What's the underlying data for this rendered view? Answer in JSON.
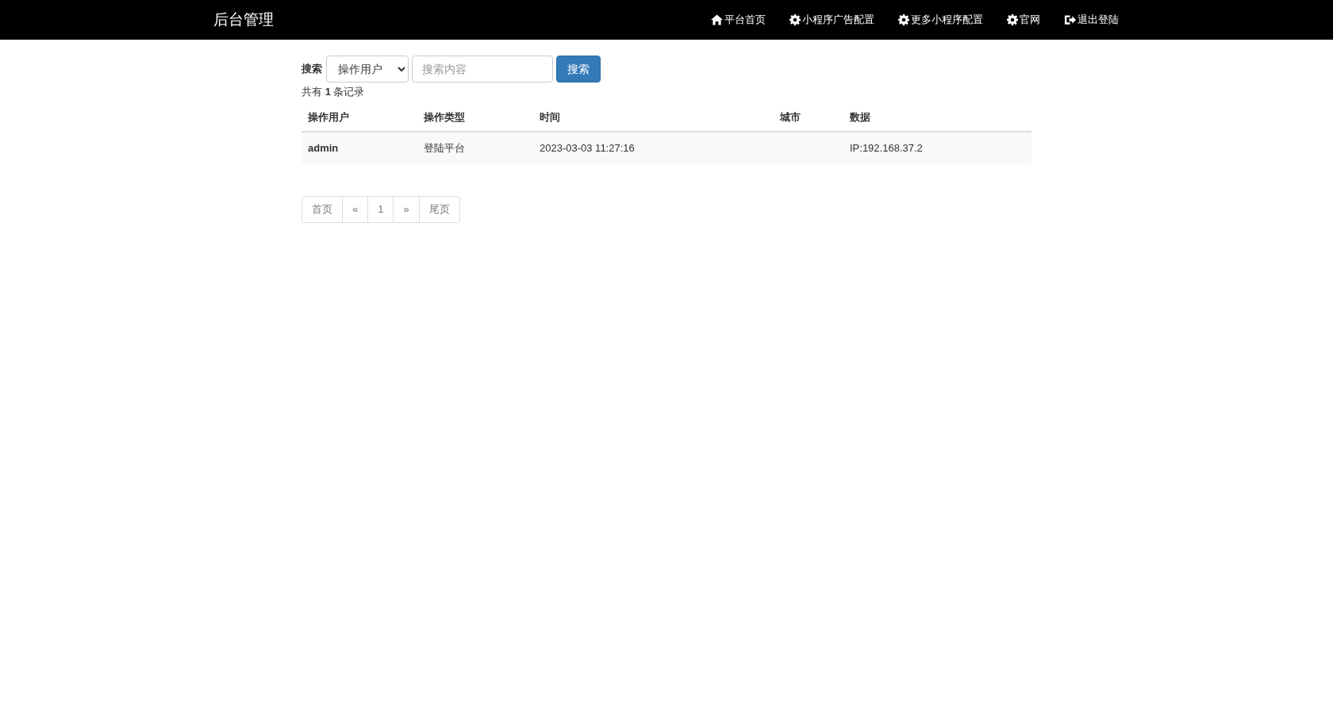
{
  "navbar": {
    "brand": "后台管理",
    "items": [
      {
        "kind": "home",
        "label": "平台首页"
      },
      {
        "kind": "gear",
        "label": "小程序广告配置"
      },
      {
        "kind": "gear",
        "label": "更多小程序配置"
      },
      {
        "kind": "gear",
        "label": "官网"
      },
      {
        "kind": "logout",
        "label": "退出登陆"
      }
    ]
  },
  "search": {
    "label": "搜索",
    "select_value": "操作用户",
    "placeholder": "搜索内容",
    "button": "搜索"
  },
  "summary": "共有 **1** 条记录",
  "table": {
    "columns": [
      "操作用户",
      "操作类型",
      "时间",
      "城市",
      "数据"
    ],
    "rows": [
      {
        "cells": [
          "admin",
          "登陆平台",
          "2023-03-03 11:27:16",
          "",
          "IP:192.168.37.2"
        ]
      }
    ]
  },
  "pagination": [
    "首页",
    "«",
    "1",
    "»",
    "尾页"
  ]
}
